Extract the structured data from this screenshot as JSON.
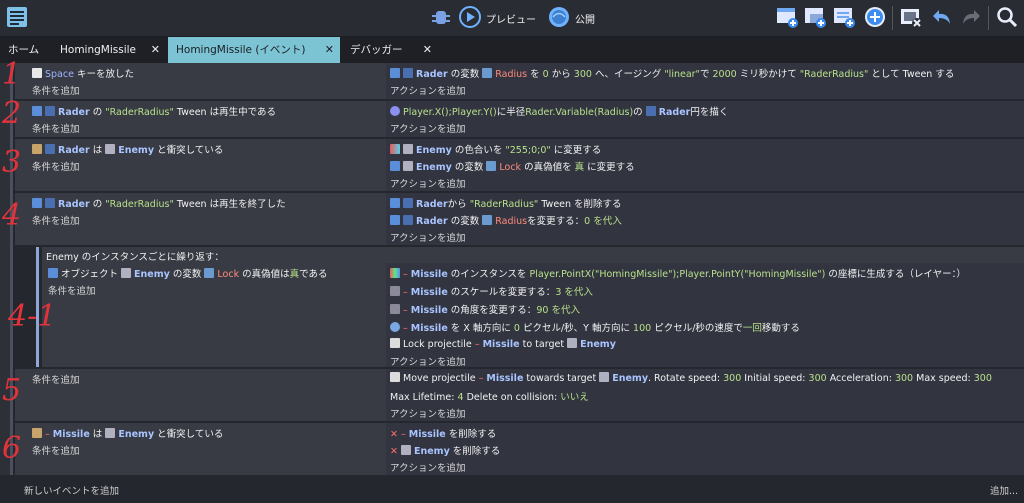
{
  "toolbar": {
    "preview_label": "プレビュー",
    "publish_label": "公開"
  },
  "tabs": [
    {
      "label": "ホーム"
    },
    {
      "label": "HomingMissile"
    },
    {
      "label": "HomingMissile (イベント)"
    },
    {
      "label": "デバッガー"
    }
  ],
  "common": {
    "add_condition": "条件を追加",
    "add_action": "アクションを追加",
    "add_event": "新しいイベントを追加",
    "add_more": "追加..."
  },
  "events": {
    "e1": {
      "cond": [
        "Space",
        "キーを放した"
      ],
      "act": [
        "Rader",
        "の変数",
        "Radius",
        "を",
        "0",
        "から",
        "300",
        "へ、イージング",
        "\"linear\"",
        "で",
        "2000",
        "ミリ秒かけて",
        "\"RaderRadius\"",
        "として Tween する"
      ]
    },
    "e2": {
      "cond": [
        "Rader",
        "の",
        "\"RaderRadius\"",
        "Tween は再生中である"
      ],
      "act": [
        "Player.X();Player.Y()",
        "に半径",
        "Rader.Variable(Radius)",
        "の",
        "Rader",
        "円を描く"
      ]
    },
    "e3": {
      "cond": [
        "Rader",
        "は",
        "Enemy",
        "と衝突している"
      ],
      "act1": [
        "Enemy",
        "の色合いを",
        "\"255;0;0\"",
        "に変更する"
      ],
      "act2": [
        "Enemy",
        "の変数",
        "Lock",
        "の真偽値を",
        "真",
        "に変更する"
      ]
    },
    "e4": {
      "cond": [
        "Rader",
        "の",
        "\"RaderRadius\"",
        "Tween は再生を終了した"
      ],
      "act1": [
        "Rader",
        "から",
        "\"RaderRadius\"",
        "Tween を削除する"
      ],
      "act2": [
        "Rader",
        "の変数",
        "Radius",
        "を変更する：",
        "0",
        "を代入"
      ]
    },
    "e41": {
      "header": "Enemy のインスタンスごとに繰り返す：",
      "cond": [
        "オブジェクト",
        "Enemy",
        "の変数",
        "Lock",
        "の真偽値は",
        "真",
        "である"
      ],
      "act1": [
        "–",
        "Missile",
        "のインスタンスを",
        "Player.PointX(\"HomingMissile\");Player.PointY(\"HomingMissile\")",
        "の座標に生成する（レイヤー：）"
      ],
      "act2": [
        "–",
        "Missile",
        "のスケールを変更する：",
        "3",
        "を代入"
      ],
      "act3": [
        "–",
        "Missile",
        "の角度を変更する：",
        "90",
        "を代入"
      ],
      "act4": [
        "–",
        "Missile",
        "を X 軸方向に",
        "0",
        "ピクセル/秒、Y 軸方向に",
        "100",
        "ピクセル/秒の速度で",
        "一回",
        "移動する"
      ],
      "act5": [
        "Lock projectile",
        "–",
        "Missile",
        "to target",
        "Enemy"
      ]
    },
    "e5": {
      "act1": [
        "Move projectile",
        "–",
        "Missile",
        "towards target",
        "Enemy",
        ". Rotate speed:",
        "300",
        "Initial speed:",
        "300",
        "Acceleration:",
        "300",
        "Max speed:",
        "300"
      ],
      "act2": [
        "Max Lifetime:",
        "4",
        "Delete on collision:",
        "いいえ"
      ]
    },
    "e6": {
      "cond": [
        "–",
        "Missile",
        "は",
        "Enemy",
        "と衝突している"
      ],
      "act1": [
        "–",
        "Missile",
        "を削除する"
      ],
      "act2": [
        "Enemy",
        "を削除する"
      ]
    }
  },
  "annotations": [
    "1",
    "2",
    "3",
    "4",
    "4-1",
    "5",
    "6"
  ]
}
